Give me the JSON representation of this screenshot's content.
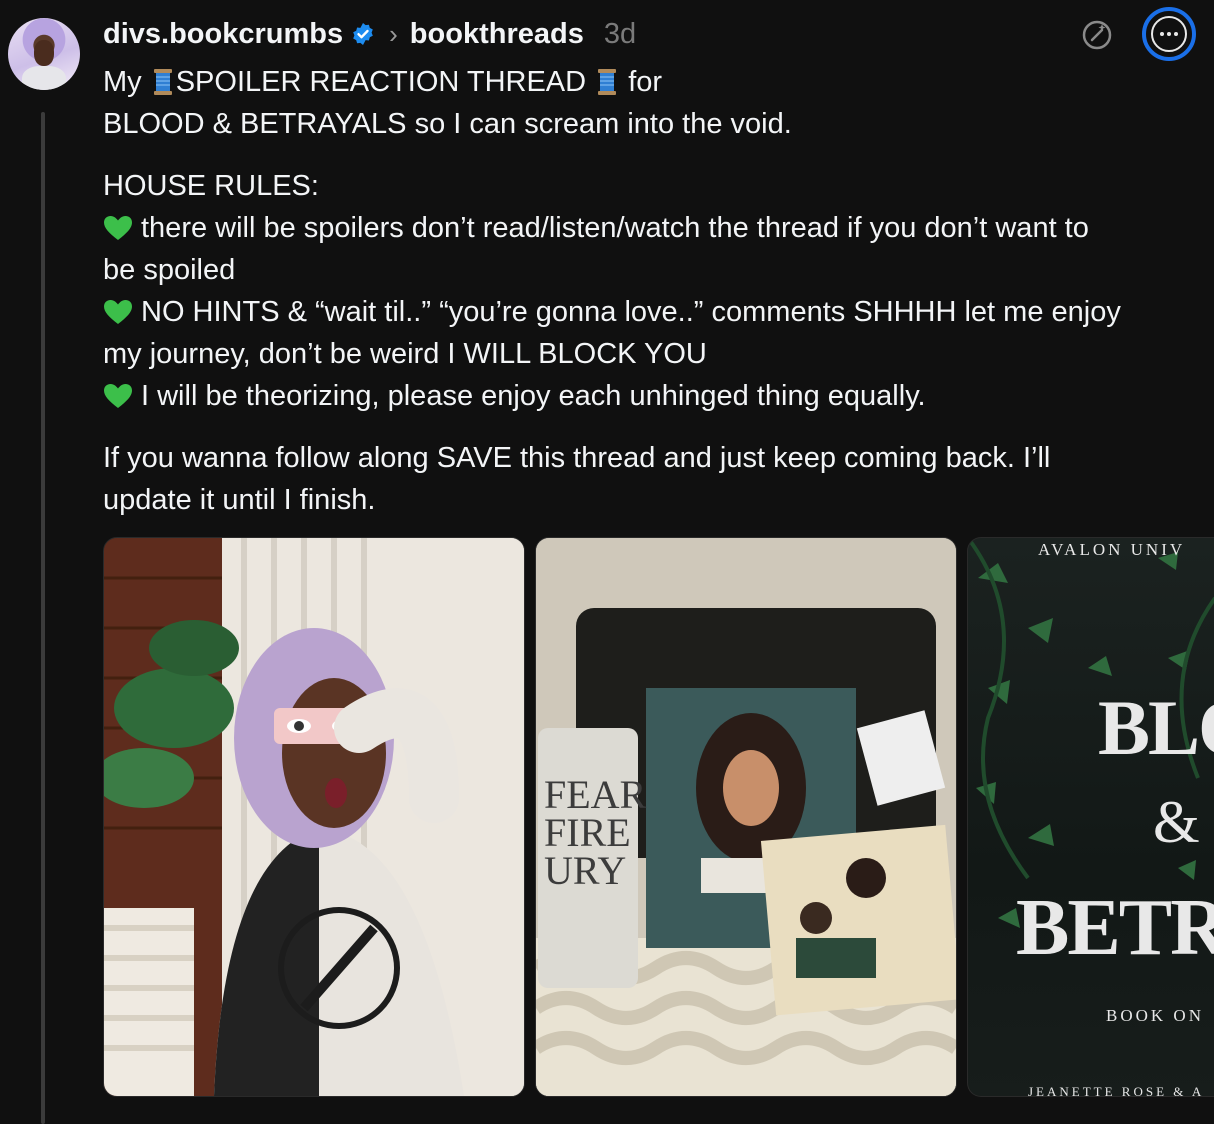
{
  "post": {
    "username": "divs.bookcrumbs",
    "topic": "bookthreads",
    "time": "3d",
    "line1_a": "My ",
    "line1_b": "SPOILER REACTION THREAD ",
    "line1_c": " for",
    "line2": "BLOOD & BETRAYALS so I can scream into the void.",
    "rules_heading": "HOUSE RULES:",
    "rule1_a": "there will be spoilers don’t read/listen/watch the thread if you don’t want to",
    "rule1_b": "be spoiled",
    "rule2_a": "NO HINTS & “wait til..” “you’re gonna love..” comments SHHHH let me enjoy",
    "rule2_b": "my journey, don’t be weird I WILL BLOCK YOU",
    "rule3": "I will be theorizing, please enjoy each unhinged thing equally.",
    "follow_a": "If you wanna follow along SAVE this thread and just keep coming back. I’ll",
    "follow_b": "update it until I finish."
  },
  "images": {
    "img2_tumbler": [
      "FEAR",
      "FIRE",
      "URY"
    ],
    "img3_top": "AVALON UNIV",
    "img3_title_a": "BLOO",
    "img3_amp": "&",
    "img3_title_b": "BETRA",
    "img3_book": "BOOK ON",
    "img3_author": "JEANETTE ROSE & A"
  },
  "colors": {
    "accent": "#1a6fe8",
    "heart": "#3cbf4a",
    "verified": "#1d8cf0"
  },
  "icons": {
    "verified": "verified-badge-icon",
    "chevron": "chevron-right-icon",
    "ai": "ai-sparkle-icon",
    "more": "more-icon",
    "spool": "spool-icon",
    "heart": "green-heart-icon"
  }
}
